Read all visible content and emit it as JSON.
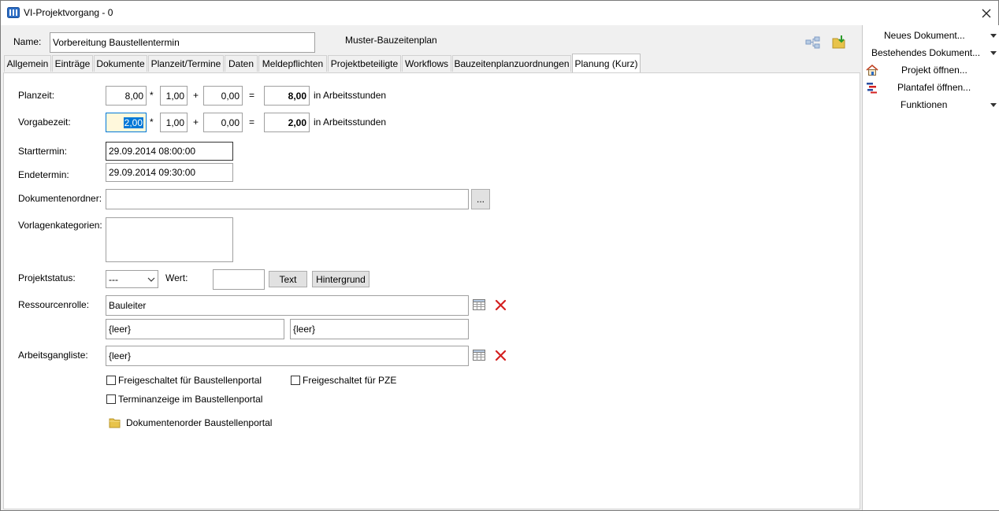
{
  "window": {
    "title": "VI-Projektvorgang - 0"
  },
  "header": {
    "name_label": "Name:",
    "name_value": "Vorbereitung Baustellentermin",
    "template_text": "Muster-Bauzeitenplan"
  },
  "tabs": [
    {
      "label": "Allgemein"
    },
    {
      "label": "Einträge"
    },
    {
      "label": "Dokumente"
    },
    {
      "label": "Planzeit/Termine"
    },
    {
      "label": "Daten"
    },
    {
      "label": "Meldepflichten"
    },
    {
      "label": "Projektbeteiligte"
    },
    {
      "label": "Workflows"
    },
    {
      "label": "Bauzeitenplanzuordnungen"
    },
    {
      "label": "Planung (Kurz)"
    }
  ],
  "form": {
    "planzeit": {
      "label": "Planzeit:",
      "a": "8,00",
      "b": "1,00",
      "c": "0,00",
      "result": "8,00",
      "unit": "in Arbeitsstunden",
      "mul": "*",
      "plus": "+",
      "eq": "="
    },
    "vorgabezeit": {
      "label": "Vorgabezeit:",
      "a": "2,00",
      "b": "1,00",
      "c": "0,00",
      "result": "2,00",
      "unit": "in Arbeitsstunden",
      "mul": "*",
      "plus": "+",
      "eq": "="
    },
    "starttermin": {
      "label": "Starttermin:",
      "value": "29.09.2014 08:00:00"
    },
    "endetermin": {
      "label": "Endetermin:",
      "value": "29.09.2014 09:30:00"
    },
    "dokumentenordner": {
      "label": "Dokumentenordner:",
      "value": "",
      "browse": "..."
    },
    "vorlagenkategorien": {
      "label": "Vorlagenkategorien:"
    },
    "projektstatus": {
      "label": "Projektstatus:",
      "value": "---",
      "wert_label": "Wert:",
      "wert_value": "",
      "text_button": "Text",
      "hintergrund_button": "Hintergrund"
    },
    "ressourcenrolle": {
      "label": "Ressourcenrolle:",
      "value": "Bauleiter",
      "sub1": "{leer}",
      "sub2": "{leer}"
    },
    "arbeitsgangliste": {
      "label": "Arbeitsgangliste:",
      "value": "{leer}"
    },
    "checkboxes": {
      "baustellenportal": {
        "label": "Freigeschaltet für Baustellenportal",
        "checked": false
      },
      "pze": {
        "label": "Freigeschaltet für PZE",
        "checked": false
      },
      "terminanzeige": {
        "label": "Terminanzeige im Baustellenportal",
        "checked": false
      }
    },
    "ordner_link": "Dokumentenorder Baustellenportal"
  },
  "sidebar": {
    "neues": "Neues Dokument...",
    "bestehendes": "Bestehendes Dokument...",
    "projekt": "Projekt öffnen...",
    "plantafel": "Plantafel öffnen...",
    "funktionen": "Funktionen"
  },
  "colors": {
    "selection": "#0078d7",
    "highlight_field": "#fff8dc",
    "delete_red": "#d42020",
    "folder": "#e8c34a"
  }
}
